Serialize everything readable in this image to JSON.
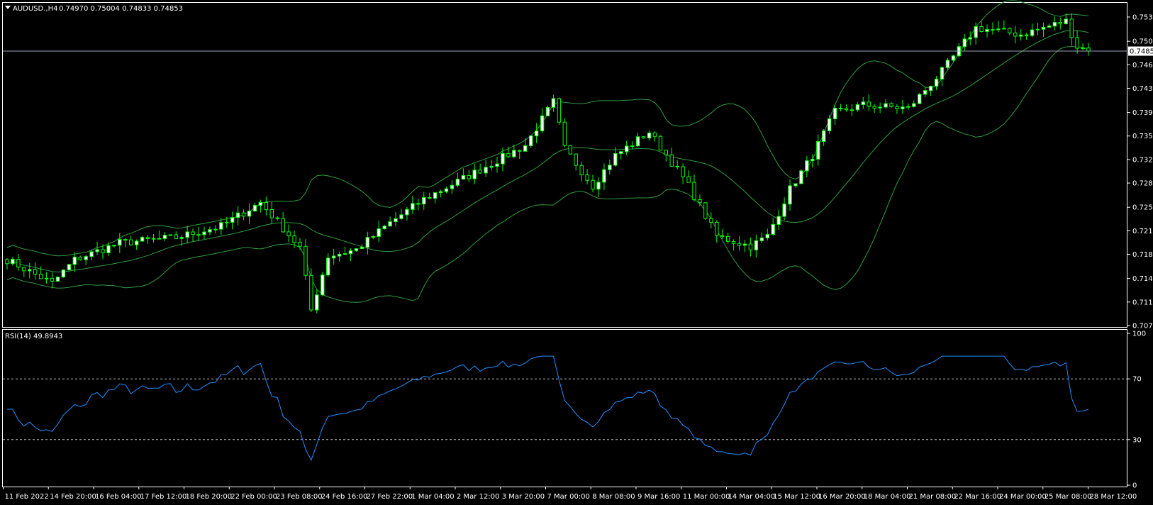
{
  "header": {
    "symbol_timeframe": "AUDUSD.,H4",
    "ohlc": "0.74970 0.75004 0.74833 0.74853"
  },
  "rsi_header": "RSI(14) 49.8943",
  "current_price_label": "0.74853",
  "colors": {
    "background": "#000000",
    "axis": "#ffffff",
    "candle": "#00ff00",
    "candle_bull_fill": "#ffffff",
    "bollinger": "#2e9e3e",
    "rsi_line": "#1e90ff",
    "level_line": "#c0c0c0"
  },
  "chart_data": [
    {
      "type": "candlestick",
      "title": "AUDUSD.,H4",
      "overlay": "Bollinger Bands",
      "ylim": [
        0.7077,
        0.7555
      ],
      "y_ticks": [
        "0.75360",
        "0.75000",
        "0.74650",
        "0.74300",
        "0.73940",
        "0.73590",
        "0.73240",
        "0.72890",
        "0.72530",
        "0.72180",
        "0.71830",
        "0.71470",
        "0.71120",
        "0.70770"
      ],
      "x_ticks": [
        "11 Feb 2022",
        "14 Feb 20:00",
        "16 Feb 04:00",
        "17 Feb 12:00",
        "18 Feb 20:00",
        "22 Feb 00:00",
        "23 Feb 08:00",
        "24 Feb 16:00",
        "27 Feb 22:00",
        "1 Mar 04:00",
        "2 Mar 12:00",
        "3 Mar 20:00",
        "7 Mar 00:00",
        "8 Mar 08:00",
        "9 Mar 16:00",
        "11 Mar 00:00",
        "14 Mar 04:00",
        "15 Mar 12:00",
        "16 Mar 20:00",
        "18 Mar 04:00",
        "21 Mar 08:00",
        "22 Mar 16:00",
        "24 Mar 00:00",
        "25 Mar 08:00",
        "28 Mar 12:00"
      ],
      "anchors": [
        [
          0,
          0.7175
        ],
        [
          8,
          0.714
        ],
        [
          12,
          0.7175
        ],
        [
          20,
          0.72
        ],
        [
          30,
          0.7208
        ],
        [
          38,
          0.7225
        ],
        [
          45,
          0.726
        ],
        [
          52,
          0.7193
        ],
        [
          54,
          0.71
        ],
        [
          57,
          0.718
        ],
        [
          62,
          0.719
        ],
        [
          68,
          0.723
        ],
        [
          74,
          0.7265
        ],
        [
          82,
          0.73
        ],
        [
          92,
          0.7345
        ],
        [
          97,
          0.741
        ],
        [
          99,
          0.734
        ],
        [
          104,
          0.7285
        ],
        [
          108,
          0.733
        ],
        [
          114,
          0.7365
        ],
        [
          118,
          0.732
        ],
        [
          121,
          0.7285
        ],
        [
          126,
          0.721
        ],
        [
          132,
          0.7195
        ],
        [
          135,
          0.721
        ],
        [
          139,
          0.728
        ],
        [
          143,
          0.733
        ],
        [
          147,
          0.7395
        ],
        [
          152,
          0.7405
        ],
        [
          160,
          0.74
        ],
        [
          166,
          0.7455
        ],
        [
          172,
          0.752
        ],
        [
          180,
          0.751
        ],
        [
          188,
          0.753
        ],
        [
          190,
          0.7492
        ],
        [
          192,
          0.7487
        ]
      ],
      "close": 0.74853
    },
    {
      "type": "line",
      "title": "RSI(14) 49.8943",
      "ylim": [
        0,
        100
      ],
      "y_ticks": [
        "100",
        "70",
        "30",
        "0"
      ],
      "levels": [
        70,
        30
      ],
      "last_value": 49.8943
    }
  ]
}
